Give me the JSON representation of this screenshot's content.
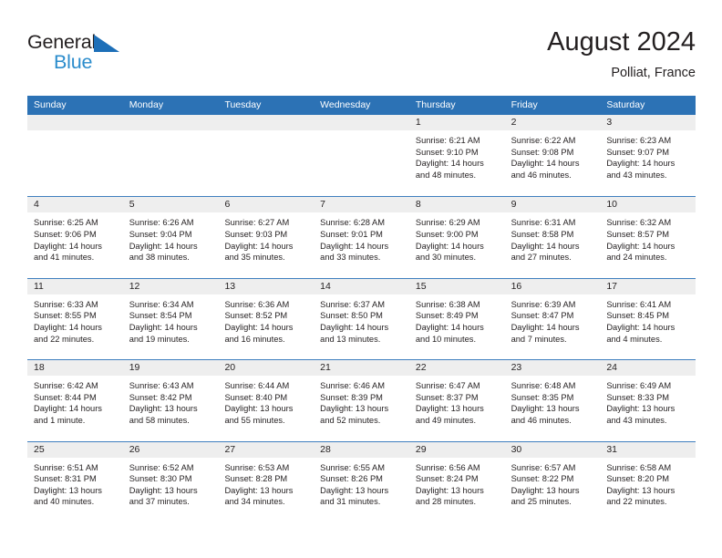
{
  "brand": {
    "name_part1": "General",
    "name_part2": "Blue",
    "triangle_color": "#1d6fb8",
    "blue_text_color": "#2b8ccc"
  },
  "header": {
    "title": "August 2024",
    "subtitle": "Polliat, France"
  },
  "theme": {
    "header_row_bg": "#2c72b5",
    "week_separator": "#3f7fbf",
    "daynum_band_bg": "#eeeeee",
    "text": "#231f20"
  },
  "weekday_headers": [
    "Sunday",
    "Monday",
    "Tuesday",
    "Wednesday",
    "Thursday",
    "Friday",
    "Saturday"
  ],
  "weeks": [
    [
      {
        "day": "",
        "empty": true
      },
      {
        "day": "",
        "empty": true
      },
      {
        "day": "",
        "empty": true
      },
      {
        "day": "",
        "empty": true
      },
      {
        "day": "1",
        "sunrise": "Sunrise: 6:21 AM",
        "sunset": "Sunset: 9:10 PM",
        "daylight": "Daylight: 14 hours and 48 minutes."
      },
      {
        "day": "2",
        "sunrise": "Sunrise: 6:22 AM",
        "sunset": "Sunset: 9:08 PM",
        "daylight": "Daylight: 14 hours and 46 minutes."
      },
      {
        "day": "3",
        "sunrise": "Sunrise: 6:23 AM",
        "sunset": "Sunset: 9:07 PM",
        "daylight": "Daylight: 14 hours and 43 minutes."
      }
    ],
    [
      {
        "day": "4",
        "sunrise": "Sunrise: 6:25 AM",
        "sunset": "Sunset: 9:06 PM",
        "daylight": "Daylight: 14 hours and 41 minutes."
      },
      {
        "day": "5",
        "sunrise": "Sunrise: 6:26 AM",
        "sunset": "Sunset: 9:04 PM",
        "daylight": "Daylight: 14 hours and 38 minutes."
      },
      {
        "day": "6",
        "sunrise": "Sunrise: 6:27 AM",
        "sunset": "Sunset: 9:03 PM",
        "daylight": "Daylight: 14 hours and 35 minutes."
      },
      {
        "day": "7",
        "sunrise": "Sunrise: 6:28 AM",
        "sunset": "Sunset: 9:01 PM",
        "daylight": "Daylight: 14 hours and 33 minutes."
      },
      {
        "day": "8",
        "sunrise": "Sunrise: 6:29 AM",
        "sunset": "Sunset: 9:00 PM",
        "daylight": "Daylight: 14 hours and 30 minutes."
      },
      {
        "day": "9",
        "sunrise": "Sunrise: 6:31 AM",
        "sunset": "Sunset: 8:58 PM",
        "daylight": "Daylight: 14 hours and 27 minutes."
      },
      {
        "day": "10",
        "sunrise": "Sunrise: 6:32 AM",
        "sunset": "Sunset: 8:57 PM",
        "daylight": "Daylight: 14 hours and 24 minutes."
      }
    ],
    [
      {
        "day": "11",
        "sunrise": "Sunrise: 6:33 AM",
        "sunset": "Sunset: 8:55 PM",
        "daylight": "Daylight: 14 hours and 22 minutes."
      },
      {
        "day": "12",
        "sunrise": "Sunrise: 6:34 AM",
        "sunset": "Sunset: 8:54 PM",
        "daylight": "Daylight: 14 hours and 19 minutes."
      },
      {
        "day": "13",
        "sunrise": "Sunrise: 6:36 AM",
        "sunset": "Sunset: 8:52 PM",
        "daylight": "Daylight: 14 hours and 16 minutes."
      },
      {
        "day": "14",
        "sunrise": "Sunrise: 6:37 AM",
        "sunset": "Sunset: 8:50 PM",
        "daylight": "Daylight: 14 hours and 13 minutes."
      },
      {
        "day": "15",
        "sunrise": "Sunrise: 6:38 AM",
        "sunset": "Sunset: 8:49 PM",
        "daylight": "Daylight: 14 hours and 10 minutes."
      },
      {
        "day": "16",
        "sunrise": "Sunrise: 6:39 AM",
        "sunset": "Sunset: 8:47 PM",
        "daylight": "Daylight: 14 hours and 7 minutes."
      },
      {
        "day": "17",
        "sunrise": "Sunrise: 6:41 AM",
        "sunset": "Sunset: 8:45 PM",
        "daylight": "Daylight: 14 hours and 4 minutes."
      }
    ],
    [
      {
        "day": "18",
        "sunrise": "Sunrise: 6:42 AM",
        "sunset": "Sunset: 8:44 PM",
        "daylight": "Daylight: 14 hours and 1 minute."
      },
      {
        "day": "19",
        "sunrise": "Sunrise: 6:43 AM",
        "sunset": "Sunset: 8:42 PM",
        "daylight": "Daylight: 13 hours and 58 minutes."
      },
      {
        "day": "20",
        "sunrise": "Sunrise: 6:44 AM",
        "sunset": "Sunset: 8:40 PM",
        "daylight": "Daylight: 13 hours and 55 minutes."
      },
      {
        "day": "21",
        "sunrise": "Sunrise: 6:46 AM",
        "sunset": "Sunset: 8:39 PM",
        "daylight": "Daylight: 13 hours and 52 minutes."
      },
      {
        "day": "22",
        "sunrise": "Sunrise: 6:47 AM",
        "sunset": "Sunset: 8:37 PM",
        "daylight": "Daylight: 13 hours and 49 minutes."
      },
      {
        "day": "23",
        "sunrise": "Sunrise: 6:48 AM",
        "sunset": "Sunset: 8:35 PM",
        "daylight": "Daylight: 13 hours and 46 minutes."
      },
      {
        "day": "24",
        "sunrise": "Sunrise: 6:49 AM",
        "sunset": "Sunset: 8:33 PM",
        "daylight": "Daylight: 13 hours and 43 minutes."
      }
    ],
    [
      {
        "day": "25",
        "sunrise": "Sunrise: 6:51 AM",
        "sunset": "Sunset: 8:31 PM",
        "daylight": "Daylight: 13 hours and 40 minutes."
      },
      {
        "day": "26",
        "sunrise": "Sunrise: 6:52 AM",
        "sunset": "Sunset: 8:30 PM",
        "daylight": "Daylight: 13 hours and 37 minutes."
      },
      {
        "day": "27",
        "sunrise": "Sunrise: 6:53 AM",
        "sunset": "Sunset: 8:28 PM",
        "daylight": "Daylight: 13 hours and 34 minutes."
      },
      {
        "day": "28",
        "sunrise": "Sunrise: 6:55 AM",
        "sunset": "Sunset: 8:26 PM",
        "daylight": "Daylight: 13 hours and 31 minutes."
      },
      {
        "day": "29",
        "sunrise": "Sunrise: 6:56 AM",
        "sunset": "Sunset: 8:24 PM",
        "daylight": "Daylight: 13 hours and 28 minutes."
      },
      {
        "day": "30",
        "sunrise": "Sunrise: 6:57 AM",
        "sunset": "Sunset: 8:22 PM",
        "daylight": "Daylight: 13 hours and 25 minutes."
      },
      {
        "day": "31",
        "sunrise": "Sunrise: 6:58 AM",
        "sunset": "Sunset: 8:20 PM",
        "daylight": "Daylight: 13 hours and 22 minutes."
      }
    ]
  ]
}
